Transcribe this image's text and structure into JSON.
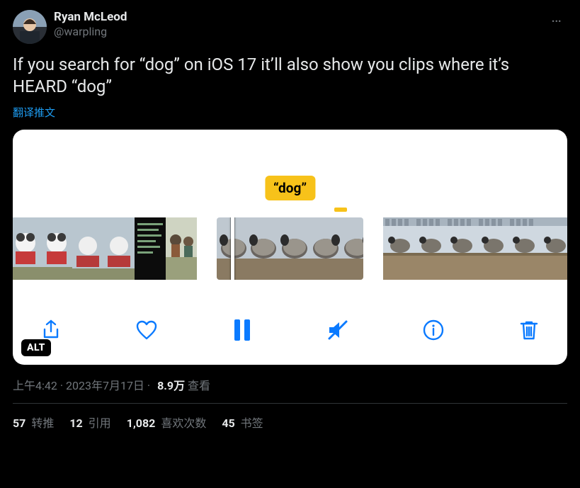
{
  "author": {
    "display_name": "Ryan McLeod",
    "handle": "@warpling"
  },
  "text": "If you search for “dog” on iOS 17 it’ll also show you clips where it’s HEARD “dog”",
  "translate_label": "翻译推文",
  "media": {
    "tag": "“dog”",
    "alt_badge": "ALT"
  },
  "meta": {
    "time": "上午4:42",
    "date": "2023年7月17日",
    "dot1": " · ",
    "dot2": " · ",
    "views_count": "8.9万",
    "views_label": " 查看"
  },
  "stats": {
    "retweets_count": "57",
    "retweets_label": " 转推",
    "quotes_count": "12",
    "quotes_label": " 引用",
    "likes_count": "1,082",
    "likes_label": " 喜欢次数",
    "bookmarks_count": "45",
    "bookmarks_label": " 书签"
  }
}
